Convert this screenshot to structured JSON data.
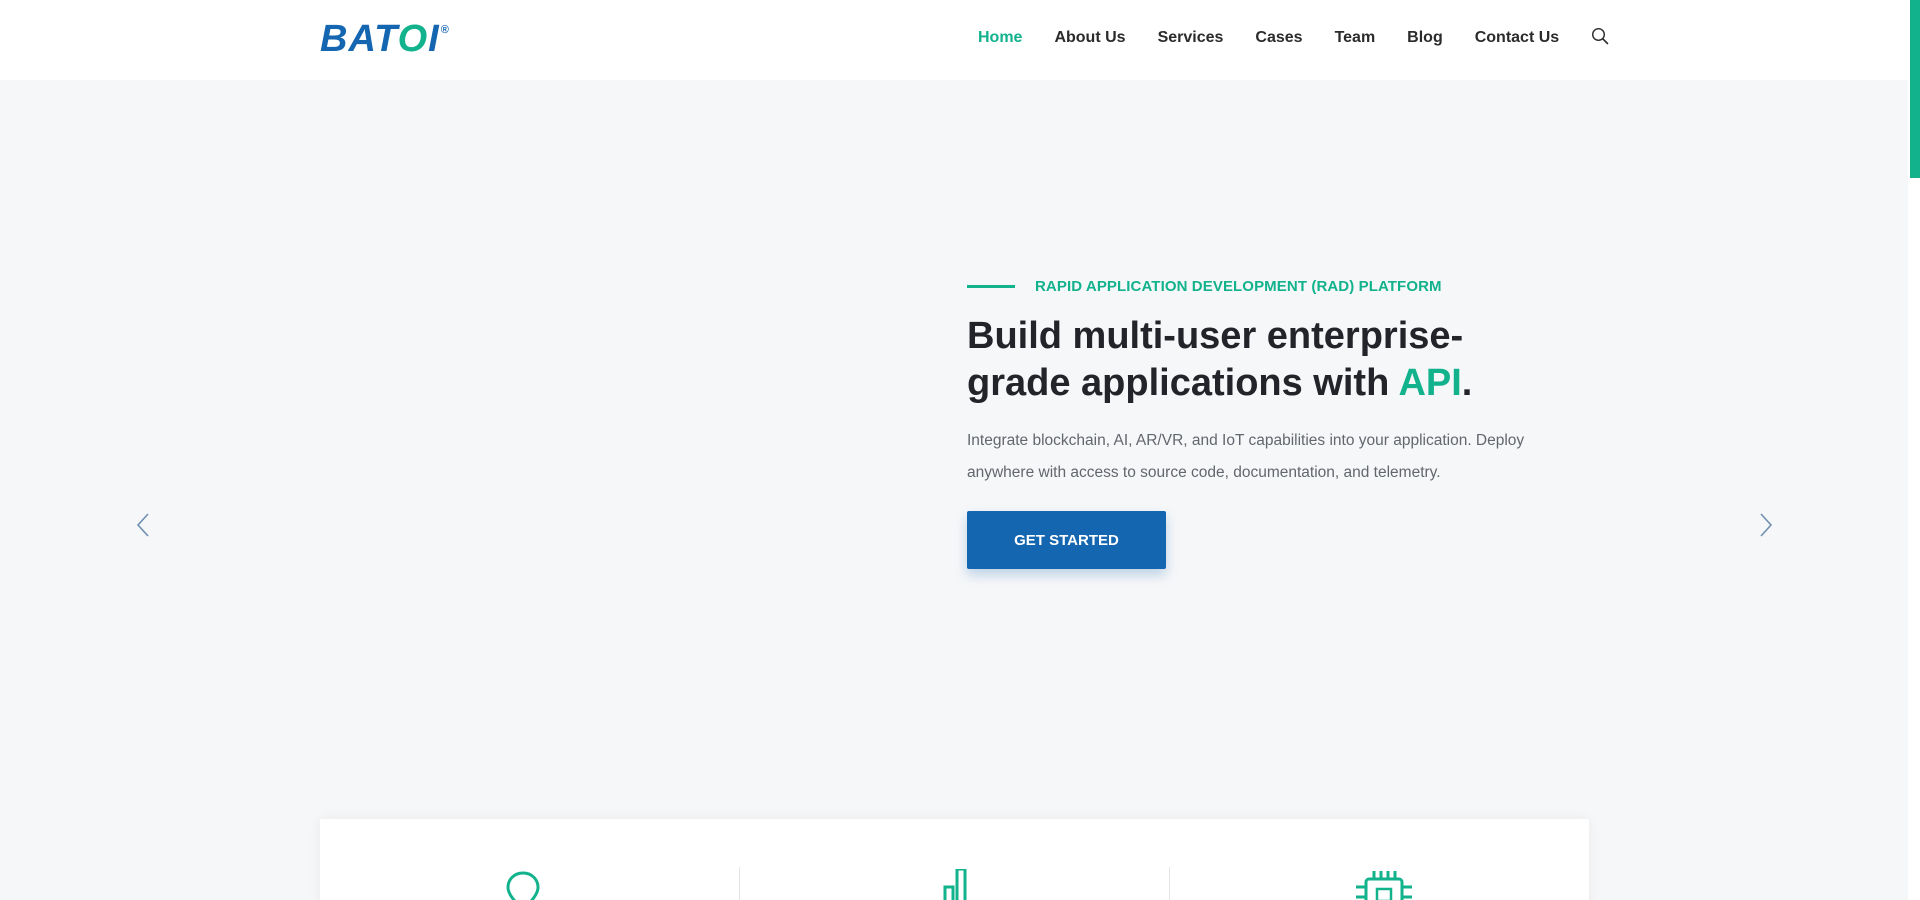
{
  "header": {
    "logo": {
      "text_main": "BAT",
      "text_o": "O",
      "text_end": "I",
      "registered": "®"
    },
    "nav": [
      {
        "label": "Home",
        "active": true
      },
      {
        "label": "About Us",
        "active": false
      },
      {
        "label": "Services",
        "active": false
      },
      {
        "label": "Cases",
        "active": false
      },
      {
        "label": "Team",
        "active": false
      },
      {
        "label": "Blog",
        "active": false
      },
      {
        "label": "Contact Us",
        "active": false
      }
    ],
    "search_icon": "search-icon"
  },
  "hero": {
    "eyebrow": "RAPID APPLICATION DEVELOPMENT (RAD) PLATFORM",
    "headline_main": "Build multi-user enterprise-grade applications with ",
    "headline_accent": "API",
    "headline_end": ".",
    "description": "Integrate blockchain, AI, AR/VR, and IoT capabilities into your application. Deploy anywhere with access to source code, documentation, and telemetry.",
    "cta_label": "GET STARTED",
    "prev_icon": "chevron-left-icon",
    "next_icon": "chevron-right-icon"
  },
  "features": {
    "icons": [
      "location-pin-icon",
      "bar-chart-icon",
      "chip-icon"
    ]
  },
  "colors": {
    "accent": "#12b28c",
    "brand": "#1566b0",
    "heading": "#23242a",
    "body_text": "#62666d",
    "background": "#f6f7f9"
  }
}
